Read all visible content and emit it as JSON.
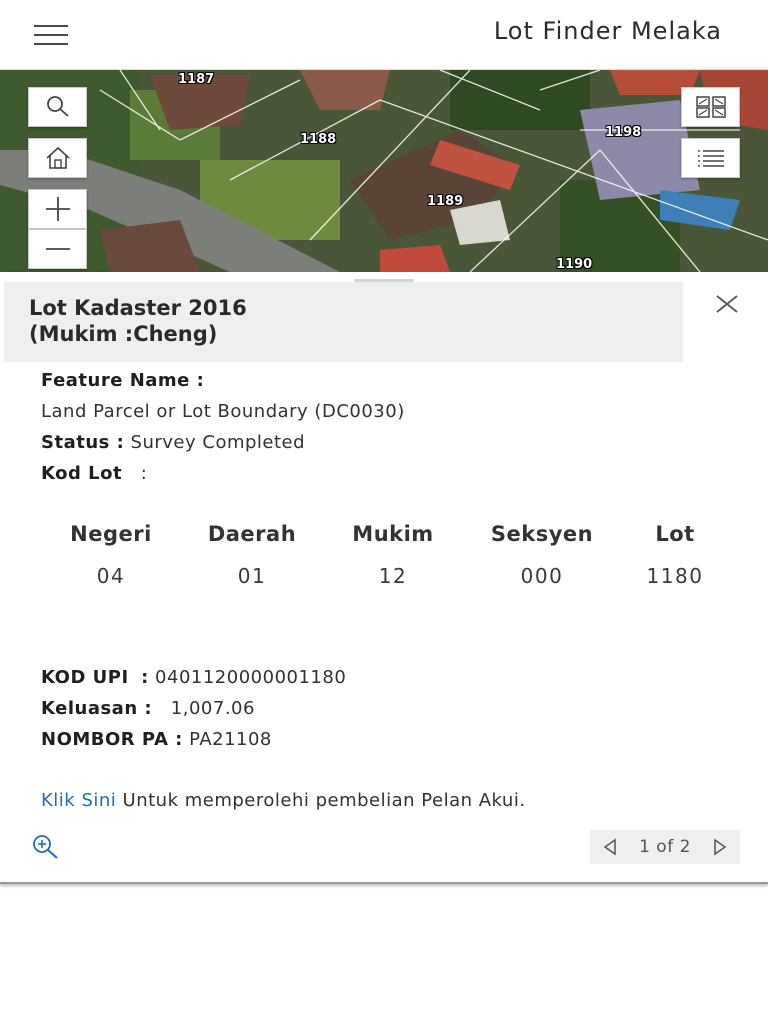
{
  "header": {
    "title": "Lot Finder Melaka"
  },
  "map": {
    "lot_labels": [
      "1187",
      "1188",
      "1189",
      "1190",
      "1198",
      "1188"
    ],
    "controls": [
      "search-icon",
      "home-icon",
      "zoom-in-icon",
      "zoom-out-icon",
      "basemap-gallery-icon",
      "layer-list-icon"
    ]
  },
  "popup": {
    "title_line1": "Lot Kadaster 2016",
    "title_line2": "(Mukim :Cheng)",
    "feature_name_label": "Feature Name :",
    "feature_name_value": "Land Parcel or Lot Boundary (DC0030)",
    "status_label": "Status :",
    "status_value": "Survey Completed",
    "kod_lot_label": "Kod Lot",
    "kod_lot_sep": ":",
    "kod_table": {
      "headers": [
        "Negeri",
        "Daerah",
        "Mukim",
        "Seksyen",
        "Lot"
      ],
      "values": [
        "04",
        "01",
        "12",
        "000",
        "1180"
      ]
    },
    "kod_upi_label": "KOD UPI",
    "kod_upi_sep": ":",
    "kod_upi_value": "0401120000001180",
    "keluasan_label": "Keluasan :",
    "keluasan_value": "1,007.06",
    "nombor_pa_label": "NOMBOR PA :",
    "nombor_pa_value": "PA21108",
    "link_text": "Klik Sini",
    "link_suffix": " Untuk memperolehi pembelian Pelan Akui.",
    "pager_text": "1 of 2"
  },
  "colors": {
    "link": "#1e6fb5",
    "header_bg": "#efefef"
  }
}
